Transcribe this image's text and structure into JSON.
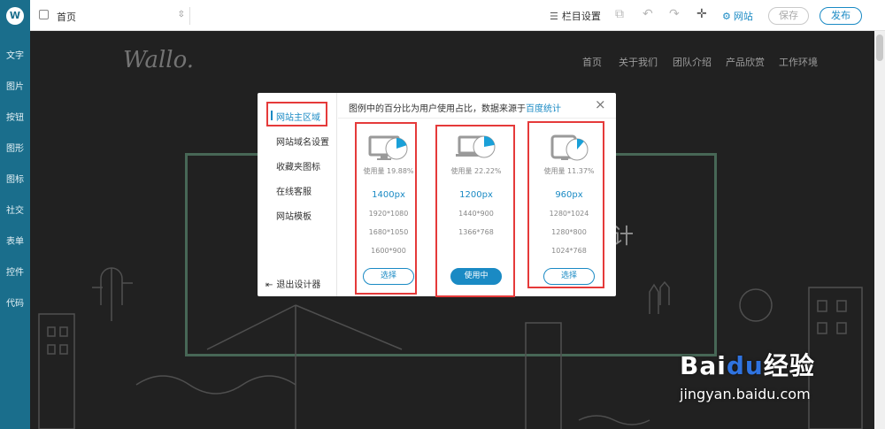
{
  "sidebar": {
    "logo": "W",
    "items": [
      "文字",
      "图片",
      "按钮",
      "图形",
      "图标",
      "社交",
      "表单",
      "控件",
      "代码"
    ]
  },
  "topbar": {
    "page": "首页",
    "column_settings": "栏目设置",
    "site": "网站",
    "save": "保存",
    "publish": "发布"
  },
  "site": {
    "logo": "Wallo.",
    "nav": [
      "首页",
      "关于我们",
      "团队介绍",
      "产品欣赏",
      "工作环境"
    ],
    "bg_text": "计"
  },
  "modal": {
    "menu": [
      "网站主区域",
      "网站域名设置",
      "收藏夹图标",
      "在线客服",
      "网站模板"
    ],
    "exit": "退出设计器",
    "header_text": "图例中的百分比为用户使用占比，数据来源于",
    "header_link": "百度统计",
    "close": "×",
    "columns": [
      {
        "usage": "使用量 19.88%",
        "usage_pct": 19.88,
        "resolution": "1400px",
        "subs": [
          "1920*1080",
          "1680*1050",
          "1600*900"
        ],
        "button": "选择",
        "active": false
      },
      {
        "usage": "使用量 22.22%",
        "usage_pct": 22.22,
        "resolution": "1200px",
        "subs": [
          "1440*900",
          "1366*768"
        ],
        "button": "使用中",
        "active": true
      },
      {
        "usage": "使用量 11.37%",
        "usage_pct": 11.37,
        "resolution": "960px",
        "subs": [
          "1280*1024",
          "1280*800",
          "1024*768"
        ],
        "button": "选择",
        "active": false
      }
    ]
  },
  "watermark": {
    "main": "Bai",
    "paw": "du",
    "cn": "经验",
    "url": "jingyan.baidu.com"
  },
  "colors": {
    "sidebar": "#1a6e8c",
    "accent": "#1a8ac4",
    "highlight": "#e53a3a",
    "frame": "#5f8a73"
  }
}
